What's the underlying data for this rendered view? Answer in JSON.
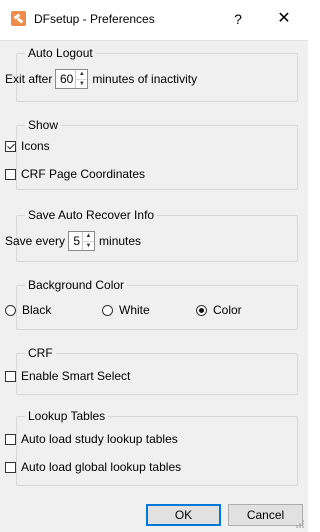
{
  "window": {
    "title": "DFsetup - Preferences",
    "help_label": "?",
    "close_label": "✕",
    "app_icon": "dfsetup-app-icon",
    "accent": "#f08a4b"
  },
  "auto_logout": {
    "title": "Auto Logout",
    "prefix": "Exit after",
    "value": "60",
    "suffix": "minutes of inactivity"
  },
  "show": {
    "title": "Show",
    "icons": {
      "label": "Icons",
      "checked": true
    },
    "crf_page_coordinates": {
      "label": "CRF Page Coordinates",
      "checked": false
    }
  },
  "save_auto_recover": {
    "title": "Save Auto Recover Info",
    "prefix": "Save every",
    "value": "5",
    "suffix": "minutes"
  },
  "background_color": {
    "title": "Background Color",
    "options": [
      {
        "label": "Black",
        "selected": false
      },
      {
        "label": "White",
        "selected": false
      },
      {
        "label": "Color",
        "selected": true
      }
    ]
  },
  "crf": {
    "title": "CRF",
    "smart_select": {
      "label": "Enable Smart Select",
      "checked": false
    }
  },
  "lookup_tables": {
    "title": "Lookup Tables",
    "study": {
      "label": "Auto load study lookup tables",
      "checked": false
    },
    "global": {
      "label": "Auto load global lookup tables",
      "checked": false
    }
  },
  "buttons": {
    "ok": "OK",
    "cancel": "Cancel"
  }
}
